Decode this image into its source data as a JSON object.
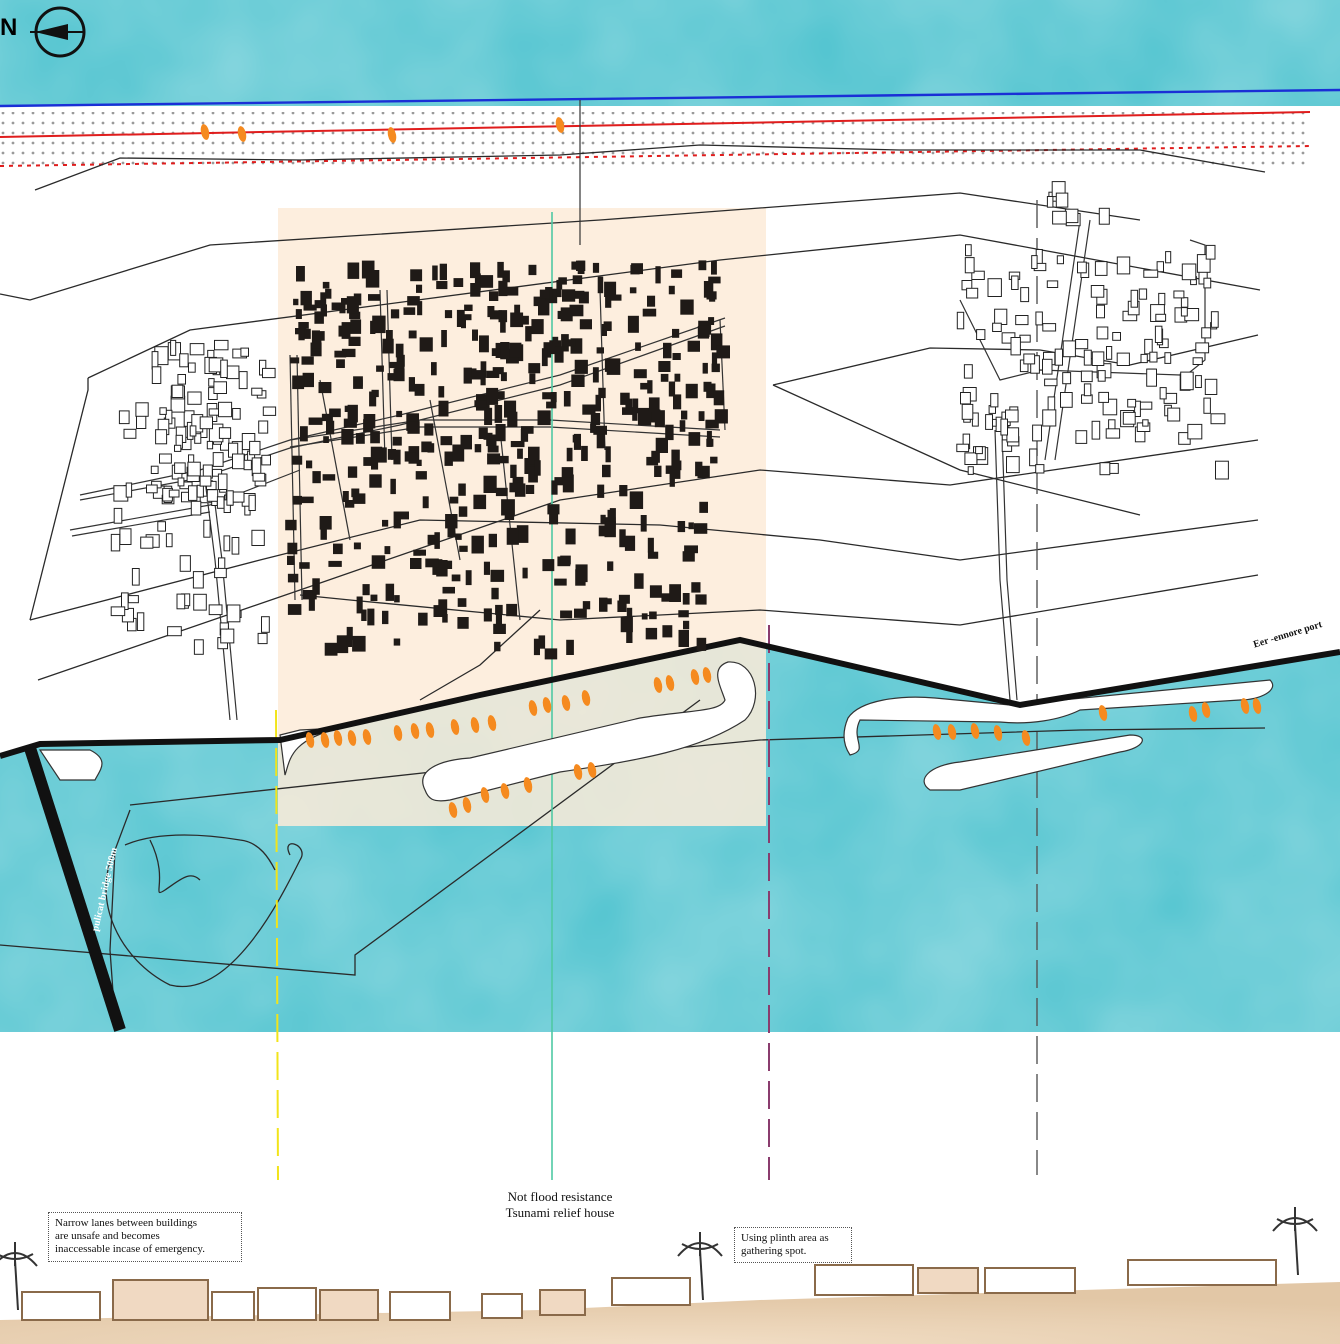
{
  "north_arrow": {
    "letter": "N",
    "icon": "north-arrow-icon"
  },
  "labels": {
    "port": "Eer -ennore port",
    "bridge": "pulicat bridge 500m"
  },
  "section": {
    "flood_note": [
      "Not flood resistance",
      "Tsunami relief house"
    ],
    "lanes_note": [
      "Narrow lanes between buildings",
      "are unsafe and becomes",
      "inaccessable incase of emergency."
    ],
    "plinth_note": [
      "Using plinth area as",
      "gathering spot."
    ]
  },
  "colors": {
    "water": "#4fc3cf",
    "sand_highlight": "#fdebd8",
    "buildings": "#1f1a17",
    "boats": "#f58a1f",
    "coastline": "#111111",
    "section_ground": "#e9d3b8",
    "line_blue": "#1a2fd6",
    "line_red": "#e01d1d",
    "marker_yellow": "#f2e41a",
    "marker_teal": "#4fc9a3",
    "marker_purple": "#8a3c6e"
  }
}
